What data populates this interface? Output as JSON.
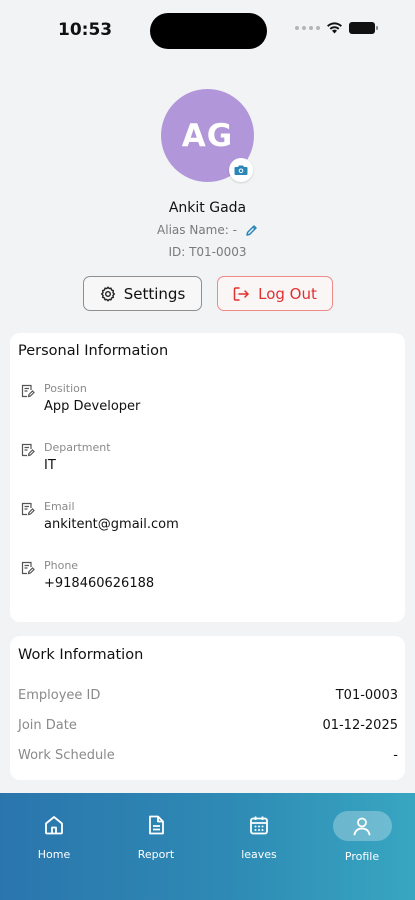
{
  "status_bar": {
    "time": "10:53"
  },
  "profile": {
    "initials": "AG",
    "name": "Ankit Gada",
    "alias": "Alias Name: -",
    "id": "ID: T01-0003",
    "avatar_color": "#b196d9"
  },
  "actions": {
    "settings_label": "Settings",
    "logout_label": "Log Out"
  },
  "personal_info": {
    "title": "Personal Information",
    "items": [
      {
        "label": "Position",
        "value": "App Developer"
      },
      {
        "label": "Department",
        "value": "IT"
      },
      {
        "label": "Email",
        "value": "ankitent@gmail.com"
      },
      {
        "label": "Phone",
        "value": "+918460626188"
      }
    ]
  },
  "work_info": {
    "title": "Work Information",
    "rows": [
      {
        "label": "Employee ID",
        "value": "T01-0003"
      },
      {
        "label": "Join Date",
        "value": "01-12-2025"
      },
      {
        "label": "Work Schedule",
        "value": "-"
      }
    ]
  },
  "nav": {
    "items": [
      {
        "label": "Home",
        "icon": "home-icon"
      },
      {
        "label": "Report",
        "icon": "report-icon"
      },
      {
        "label": "leaves",
        "icon": "calendar-icon"
      },
      {
        "label": "Profile",
        "icon": "profile-icon",
        "active": true
      }
    ]
  }
}
